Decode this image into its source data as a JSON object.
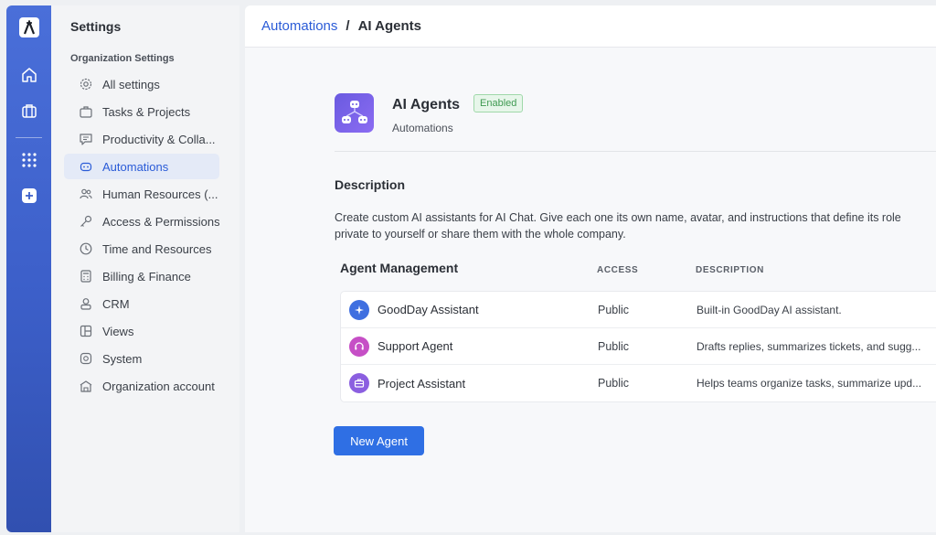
{
  "rail": {
    "icons": [
      "logo",
      "home-icon",
      "briefcase-icon",
      "apps-grid-icon",
      "plus-icon"
    ]
  },
  "sidebar": {
    "title": "Settings",
    "group_label": "Organization Settings",
    "items": [
      {
        "label": "All settings",
        "icon": "gear-icon"
      },
      {
        "label": "Tasks & Projects",
        "icon": "briefcase-icon"
      },
      {
        "label": "Productivity & Colla...",
        "icon": "chat-icon"
      },
      {
        "label": "Automations",
        "icon": "robot-icon",
        "active": true
      },
      {
        "label": "Human Resources (...",
        "icon": "people-icon"
      },
      {
        "label": "Access & Permissions",
        "icon": "key-icon"
      },
      {
        "label": "Time and Resources",
        "icon": "clock-icon"
      },
      {
        "label": "Billing & Finance",
        "icon": "calculator-icon"
      },
      {
        "label": "CRM",
        "icon": "contact-icon"
      },
      {
        "label": "Views",
        "icon": "layout-icon"
      },
      {
        "label": "System",
        "icon": "system-icon"
      },
      {
        "label": "Organization account",
        "icon": "building-icon"
      }
    ]
  },
  "breadcrumb": {
    "parent": "Automations",
    "separator": "/",
    "current": "AI Agents"
  },
  "app": {
    "title": "AI Agents",
    "status": "Enabled",
    "subtitle": "Automations"
  },
  "description": {
    "heading": "Description",
    "line1": "Create custom AI assistants for AI Chat. Give each one its own name, avatar, and instructions that define its role",
    "line2": "private to yourself or share them with the whole company."
  },
  "agents": {
    "heading": "Agent Management",
    "col_access": "ACCESS",
    "col_description": "DESCRIPTION",
    "rows": [
      {
        "name": "GoodDay Assistant",
        "access": "Public",
        "description": "Built-in GoodDay AI assistant.",
        "color": "#3f6fe0",
        "icon": "sparkle-icon"
      },
      {
        "name": "Support Agent",
        "access": "Public",
        "description": "Drafts replies, summarizes tickets, and sugg...",
        "color": "#c64fc6",
        "icon": "headset-icon"
      },
      {
        "name": "Project Assistant",
        "access": "Public",
        "description": "Helps teams organize tasks, summarize upd...",
        "color": "#8b5fe0",
        "icon": "briefcase-icon"
      }
    ]
  },
  "new_agent_button": "New Agent",
  "colors": {
    "accent": "#2f6fe4",
    "rail": "#4a6fd9",
    "enabled_badge": "#3f9a52"
  }
}
